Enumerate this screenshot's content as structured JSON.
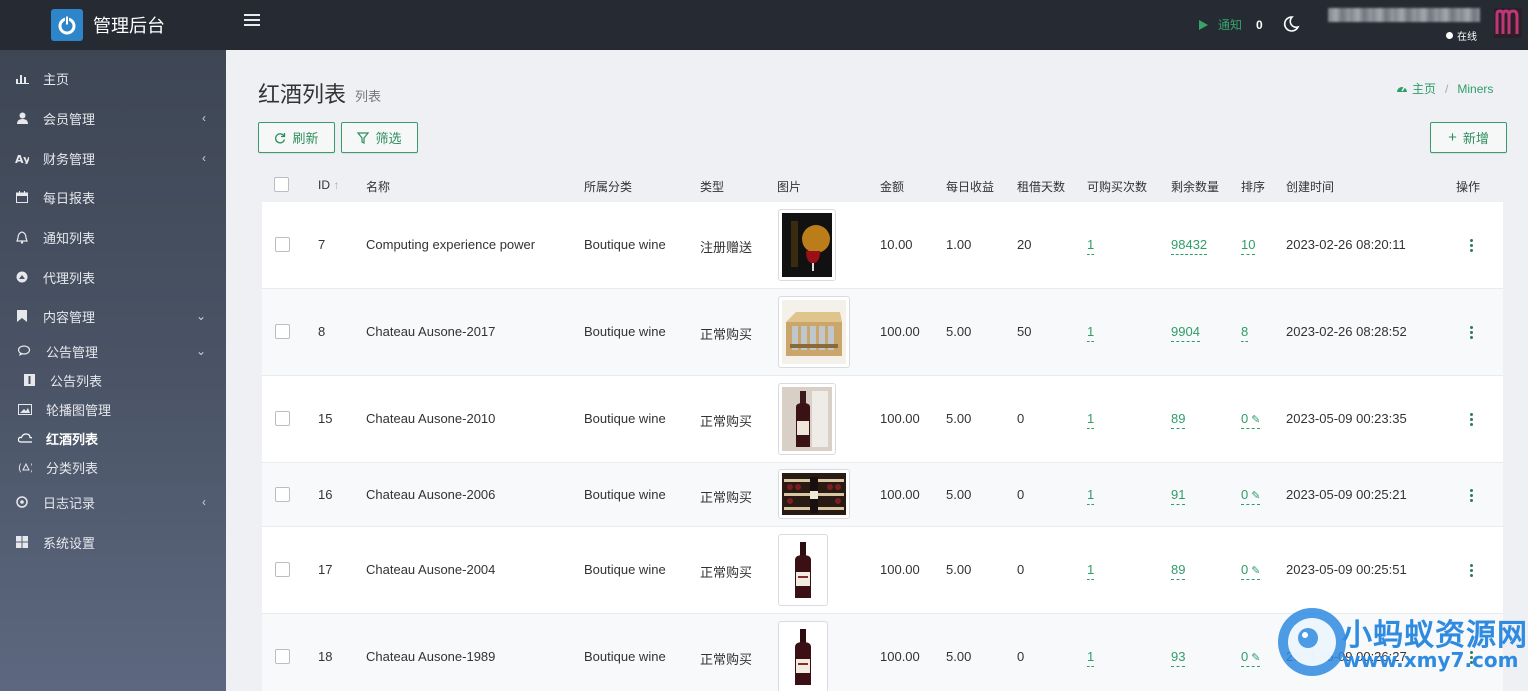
{
  "app": {
    "title": "管理后台"
  },
  "sidebar": {
    "items": [
      {
        "label": "主页",
        "icon": "bar-chart-icon"
      },
      {
        "label": "会员管理",
        "icon": "user-icon"
      },
      {
        "label": "财务管理",
        "icon": "finance-icon"
      },
      {
        "label": "每日报表",
        "icon": "calendar-icon"
      },
      {
        "label": "通知列表",
        "icon": "bell-icon"
      },
      {
        "label": "代理列表",
        "icon": "agent-icon"
      },
      {
        "label": "内容管理",
        "icon": "bookmark-icon"
      },
      {
        "label": "公告管理",
        "icon": "comments-icon"
      },
      {
        "label": "公告列表",
        "icon": "list-icon"
      },
      {
        "label": "轮播图管理",
        "icon": "image-icon"
      },
      {
        "label": "红酒列表",
        "icon": "cloud-icon"
      },
      {
        "label": "分类列表",
        "icon": "category-icon"
      },
      {
        "label": "日志记录",
        "icon": "log-icon"
      },
      {
        "label": "系统设置",
        "icon": "windows-icon"
      }
    ]
  },
  "topbar": {
    "notify_label": "通知",
    "notify_count": "0",
    "status": "在线"
  },
  "header": {
    "title": "红酒列表",
    "subtitle": "列表"
  },
  "breadcrumb": {
    "home": "主页",
    "current": "Miners"
  },
  "toolbar": {
    "refresh_label": "刷新",
    "filter_label": "筛选",
    "add_label": "新增"
  },
  "table": {
    "columns": [
      "ID",
      "名称",
      "所属分类",
      "类型",
      "图片",
      "金额",
      "每日收益",
      "租借天数",
      "可购买次数",
      "剩余数量",
      "排序",
      "创建时间",
      "操作"
    ],
    "rows": [
      {
        "id": "7",
        "name": "Computing experience power",
        "category": "Boutique wine",
        "type": "注册赠送",
        "image": "wine-glass",
        "amount": "10.00",
        "daily": "1.00",
        "days": "20",
        "buy_times": "1",
        "remaining": "98432",
        "sort": "10",
        "created": "2023-02-26 08:20:11"
      },
      {
        "id": "8",
        "name": "Chateau Ausone-2017",
        "category": "Boutique wine",
        "type": "正常购买",
        "image": "wine-case",
        "amount": "100.00",
        "daily": "5.00",
        "days": "50",
        "buy_times": "1",
        "remaining": "9904",
        "sort": "8",
        "created": "2023-02-26 08:28:52"
      },
      {
        "id": "15",
        "name": "Chateau Ausone-2010",
        "category": "Boutique wine",
        "type": "正常购买",
        "image": "bottle-photo",
        "amount": "100.00",
        "daily": "5.00",
        "days": "0",
        "buy_times": "1",
        "remaining": "89",
        "sort": "0",
        "created": "2023-05-09 00:23:35"
      },
      {
        "id": "16",
        "name": "Chateau Ausone-2006",
        "category": "Boutique wine",
        "type": "正常购买",
        "image": "wine-cellar",
        "amount": "100.00",
        "daily": "5.00",
        "days": "0",
        "buy_times": "1",
        "remaining": "91",
        "sort": "0",
        "created": "2023-05-09 00:25:21"
      },
      {
        "id": "17",
        "name": "Chateau Ausone-2004",
        "category": "Boutique wine",
        "type": "正常购买",
        "image": "bottle",
        "amount": "100.00",
        "daily": "5.00",
        "days": "0",
        "buy_times": "1",
        "remaining": "89",
        "sort": "0",
        "created": "2023-05-09 00:25:51"
      },
      {
        "id": "18",
        "name": "Chateau Ausone-1989",
        "category": "Boutique wine",
        "type": "正常购买",
        "image": "bottle",
        "amount": "100.00",
        "daily": "5.00",
        "days": "0",
        "buy_times": "1",
        "remaining": "93",
        "sort": "0",
        "created": "2023-05-09 00:26:27"
      }
    ]
  },
  "watermark": {
    "text": "小蚂蚁资源网",
    "url": "www.xmy7.com"
  },
  "colors": {
    "accent": "#2f9d6a",
    "sidebar_top": "#3c4451",
    "topbar": "#262b33"
  }
}
